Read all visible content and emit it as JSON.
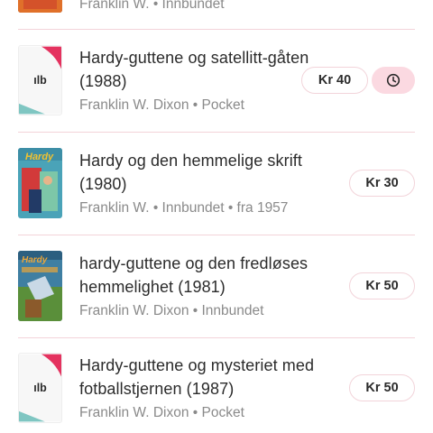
{
  "colors": {
    "accent_pink": "#e4325f",
    "divider": "#f3d3d9",
    "teal": "#7fc6c2",
    "meta_text": "#8a8a8a"
  },
  "items": [
    {
      "title": "",
      "meta": "Franklin W. • Innbundet",
      "cover": "book-cover-image"
    },
    {
      "title": "Hardy-guttene og satellitt-gåten (1988)",
      "meta": "Franklin W. Dixon • Pocket",
      "price": "Kr 40",
      "cover": "placeholder-logo",
      "logo_text": "ılb",
      "reminder_icon": "clock-icon"
    },
    {
      "title": "Hardy og den hemmelige skrift  (1980)",
      "meta": "Franklin W. • Innbundet • fra 1957",
      "price": "Kr 30",
      "cover": "book-cover-image"
    },
    {
      "title": "hardy-guttene og den fredløses hemmelighet (1981)",
      "meta": "Franklin W. Dixon • Innbundet",
      "price": "Kr 50",
      "cover": "book-cover-image"
    },
    {
      "title": "Hardy-guttene og mysteriet med fotballstjernen (1987)",
      "meta": "Franklin W. Dixon • Pocket",
      "price": "Kr 50",
      "cover": "placeholder-logo",
      "logo_text": "ılb"
    }
  ]
}
